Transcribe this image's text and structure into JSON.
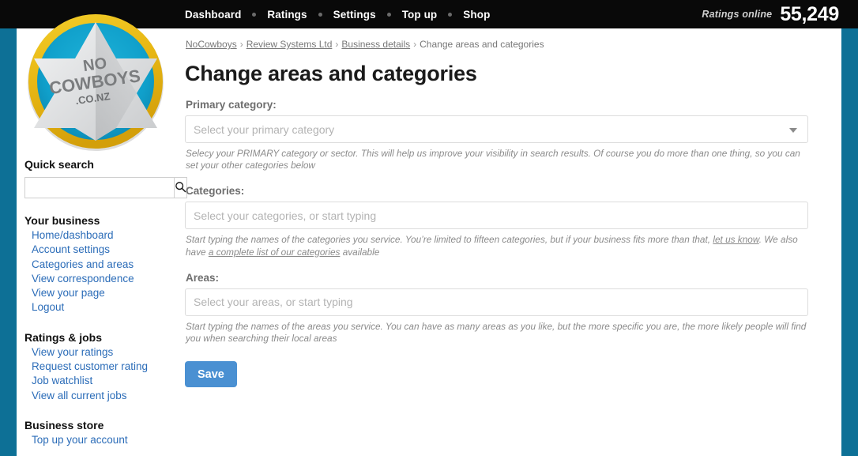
{
  "topbar": {
    "nav": [
      {
        "label": "Dashboard"
      },
      {
        "label": "Ratings"
      },
      {
        "label": "Settings"
      },
      {
        "label": "Top up"
      },
      {
        "label": "Shop"
      }
    ],
    "ratings_online_label": "Ratings online",
    "ratings_online_count": "55,249"
  },
  "logo": {
    "line1": "NO",
    "line2": "COWBOYS",
    "line3": ".CO.NZ",
    "ring_color": "#e8b91c",
    "disc_color": "#12a0cc",
    "star_color": "#d9dadb"
  },
  "sidebar": {
    "quick_search_title": "Quick search",
    "quick_search_value": "",
    "quick_search_placeholder": "",
    "groups": [
      {
        "title": "Your business",
        "links": [
          {
            "label": "Home/dashboard"
          },
          {
            "label": "Account settings"
          },
          {
            "label": "Categories and areas"
          },
          {
            "label": "View correspondence"
          },
          {
            "label": "View your page"
          },
          {
            "label": "Logout"
          }
        ]
      },
      {
        "title": "Ratings & jobs",
        "links": [
          {
            "label": "View your ratings"
          },
          {
            "label": "Request customer rating"
          },
          {
            "label": "Job watchlist"
          },
          {
            "label": "View all current jobs"
          }
        ]
      },
      {
        "title": "Business store",
        "links": [
          {
            "label": "Top up your account"
          }
        ]
      }
    ]
  },
  "main": {
    "breadcrumb": [
      {
        "label": "NoCowboys",
        "link": true
      },
      {
        "label": "Review Systems Ltd",
        "link": true
      },
      {
        "label": "Business details",
        "link": true
      },
      {
        "label": "Change areas and categories",
        "link": false
      }
    ],
    "breadcrumb_separator": "›",
    "title": "Change areas and categories",
    "primary_category": {
      "label": "Primary category:",
      "placeholder": "Select your primary category",
      "value": "",
      "help": "Selecy your PRIMARY category or sector. This will help us improve your visibility in search results. Of course you do more than one thing, so you can set your other categories below"
    },
    "categories": {
      "label": "Categories:",
      "placeholder": "Select your categories, or start typing",
      "value": "",
      "help_part1": "Start typing the names of the categories you service. You’re limited to fifteen categories, but if your business fits more than that, ",
      "help_link1": "let us know",
      "help_part2": ". We also have ",
      "help_link2": "a complete list of our categories",
      "help_part3": " available"
    },
    "areas": {
      "label": "Areas:",
      "placeholder": "Select your areas, or start typing",
      "value": "",
      "help": "Start typing the names of the areas you service. You can have as many areas as you like, but the more specific you are, the more likely people will find you when searching their local areas"
    },
    "save_label": "Save",
    "save_color": "#4a90d2"
  }
}
